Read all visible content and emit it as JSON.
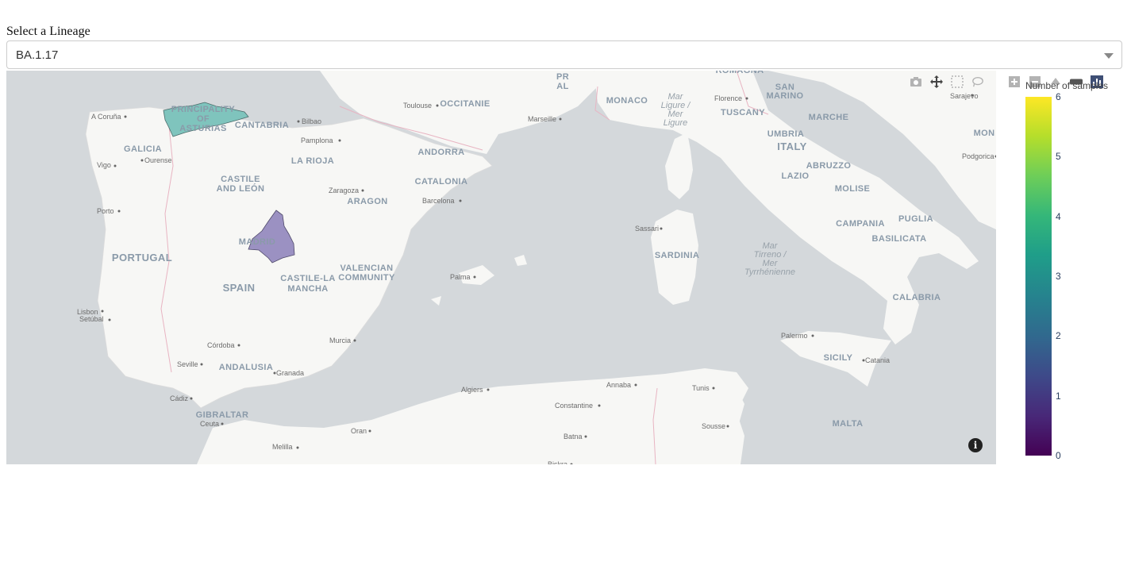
{
  "selector": {
    "label": "Select a Lineage",
    "value": "BA.1.17"
  },
  "map": {
    "highlighted_regions": [
      {
        "name": "PRINCIPALITY OF ASTURIAS",
        "samples": 3,
        "color": "#7fc4bd"
      },
      {
        "name": "MADRID",
        "samples": 1,
        "color": "#9b91c2"
      }
    ],
    "region_labels": {
      "asturias_1": "PRINCIPALITY",
      "asturias_2": "OF",
      "asturias_3": "ASTURIAS",
      "cantabria": "CANTABRIA",
      "galicia": "GALICIA",
      "castile_1": "CASTILE",
      "castile_2": "AND LEÓN",
      "la_rioja": "LA RIOJA",
      "andorra": "ANDORRA",
      "catalonia": "CATALONIA",
      "aragon": "ARAGON",
      "occitanie": "OCCITANIE",
      "monaco": "MONACO",
      "tuscany": "TUSCANY",
      "san_1": "SAN",
      "san_2": "MARINO",
      "marche": "MARCHE",
      "umbria": "UMBRIA",
      "italy": "ITALY",
      "abruzzo": "ABRUZZO",
      "lazio": "LAZIO",
      "molise": "MOLISE",
      "campania": "CAMPANIA",
      "puglia": "PUGLIA",
      "basilicata": "BASILICATA",
      "calabria": "CALABRIA",
      "sardinia": "SARDINIA",
      "sicily": "SICILY",
      "malta": "MALTA",
      "portugal": "PORTUGAL",
      "spain": "SPAIN",
      "madrid": "MADRID",
      "castile_la_1": "CASTILE-LA",
      "castile_la_2": "MANCHA",
      "valencian_1": "VALENCIAN",
      "valencian_2": "COMMUNITY",
      "andalusia": "ANDALUSIA",
      "gibraltar": "GIBRALTAR",
      "romagna": "ROMAGNA",
      "pr": "PR",
      "al": "AL",
      "mon": "MON"
    },
    "city_labels": {
      "a_coruna": "A Coruña",
      "bilbao": "Bilbao",
      "pamplona": "Pamplona",
      "ourense": "Ourense",
      "vigo": "Vigo",
      "toulouse": "Toulouse",
      "marseille": "Marseille",
      "florence": "Florence",
      "sarajevo": "Sarajevo",
      "zaragoza": "Zaragoza",
      "barcelona": "Barcelona",
      "porto": "Porto",
      "sassari": "Sassari",
      "palma": "Palma",
      "lisbon": "Lisbon",
      "setubal": "Setúbal",
      "cordoba": "Córdoba",
      "murcia": "Murcia",
      "seville": "Seville",
      "granada": "Granada",
      "cadiz": "Cádiz",
      "ceuta": "Ceuta",
      "algiers": "Algiers",
      "annaba": "Annaba",
      "tunis": "Tunis",
      "constantine": "Constantine",
      "palermo": "Palermo",
      "catania": "Catania",
      "oran": "Oran",
      "batna": "Batna",
      "sousse": "Sousse",
      "melilla": "Melilla",
      "podgorica": "Podgorica",
      "biskra": "Biskra"
    },
    "sea_labels": {
      "ligure_1": "Mar",
      "ligure_2": "Ligure /",
      "ligure_3": "Mer",
      "ligure_4": "Ligure",
      "tirreno_1": "Mar",
      "tirreno_2": "Tirreno /",
      "tirreno_3": "Mer",
      "tirreno_4": "Tyrrhénienne"
    },
    "colors": {
      "sea": "#d4d8db",
      "land": "#f7f7f5",
      "border": "#e8b4c2"
    }
  },
  "colorbar": {
    "title": "Number of samples",
    "ticks": [
      "6",
      "5",
      "4",
      "3",
      "2",
      "1",
      "0"
    ],
    "min": 0,
    "max": 6,
    "colorscale": "Viridis"
  },
  "toolbar": {
    "icons": [
      "camera-icon",
      "pan-icon",
      "box-select-icon",
      "lasso-icon",
      "zoom-in-icon",
      "zoom-out-icon",
      "reset-icon",
      "home-icon",
      "plotly-logo-icon"
    ]
  },
  "attribution_icon": "info-icon"
}
